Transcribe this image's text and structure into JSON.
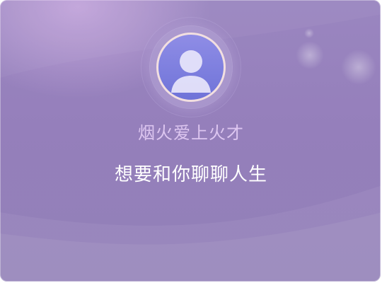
{
  "profile": {
    "nickname": "烟火爱上火才",
    "avatar_icon": "user-avatar-placeholder-icon"
  },
  "card": {
    "message": "想要和你聊聊人生"
  },
  "colors": {
    "background": "#9a86c0",
    "nickname_text": "#ddc6f0",
    "message_text": "#ffffff",
    "avatar_fill": "#7f80df",
    "avatar_border": "#f2dfe0"
  }
}
